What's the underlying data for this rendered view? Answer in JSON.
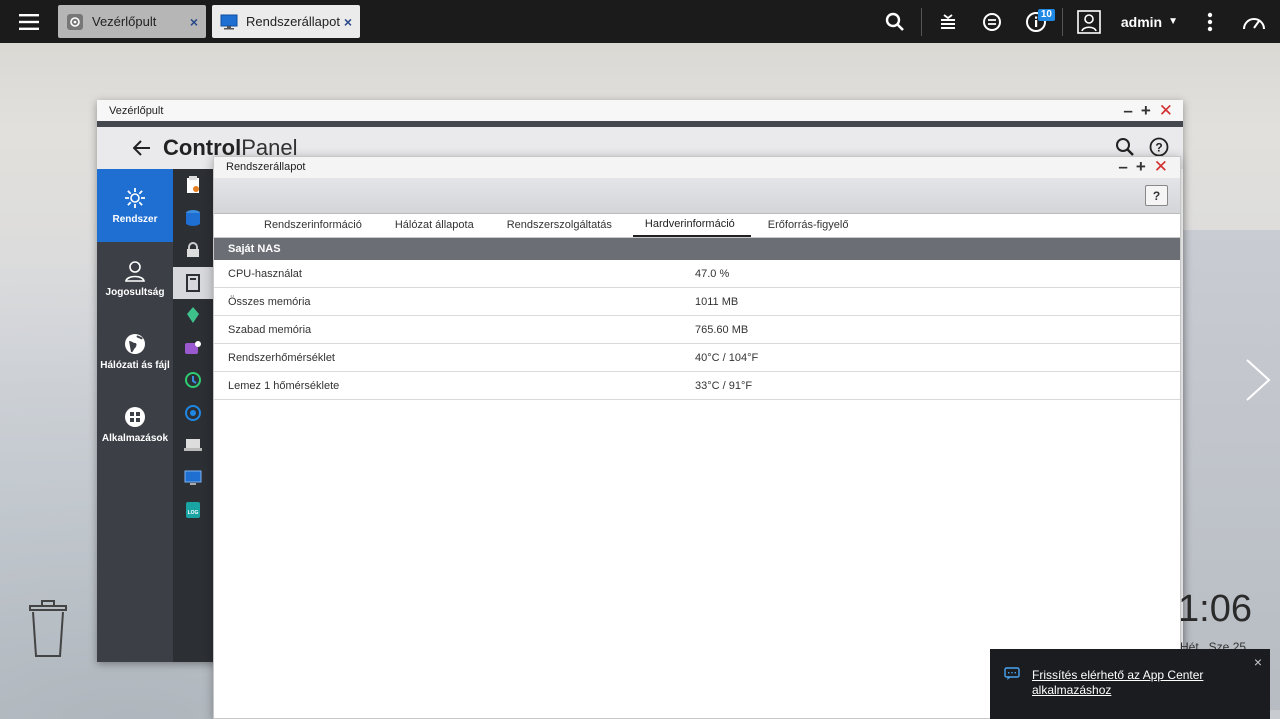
{
  "taskbar": {
    "tabs": [
      {
        "label": "Vezérlőpult",
        "close": "×"
      },
      {
        "label": "Rendszerállapot",
        "close": "×"
      }
    ],
    "notifications_count": "10",
    "user": "admin"
  },
  "control_panel": {
    "window_title": "Vezérlőpult",
    "title_bold": "Control",
    "title_light": "Panel",
    "sidebar": [
      {
        "label": "Rendszer",
        "icon": "gear-icon"
      },
      {
        "label": "Jogosultság",
        "icon": "user-icon"
      },
      {
        "label": "Hálózati ás fájl",
        "icon": "globe-icon"
      },
      {
        "label": "Alkalmazások",
        "icon": "apps-icon"
      }
    ]
  },
  "status_window": {
    "title": "Rendszerállapot",
    "help": "?",
    "tabs": [
      "Rendszerinformáció",
      "Hálózat állapota",
      "Rendszerszolgáltatás",
      "Hardverinformáció",
      "Erőforrás-figyelő"
    ],
    "active_tab": "Hardverinformáció",
    "section": "Saját NAS",
    "rows": [
      {
        "key": "CPU-használat",
        "value": "47.0 %"
      },
      {
        "key": "Összes memória",
        "value": "1011 MB"
      },
      {
        "key": "Szabad memória",
        "value": "765.60 MB"
      },
      {
        "key": "Rendszerhőmérséklet",
        "value": "40°C / 104°F"
      },
      {
        "key": "Lemez 1 hőmérséklete",
        "value": "33°C / 91°F"
      }
    ]
  },
  "desktop": {
    "clock": "1:06",
    "date": "Hét., Sze 25"
  },
  "notification": {
    "text": "Frissítés elérhető az App Center alkalmazáshoz",
    "close": "×"
  },
  "colors": {
    "accent": "#1e6fd1",
    "close_red": "#d32f2f",
    "section_header": "#6b6e75"
  }
}
